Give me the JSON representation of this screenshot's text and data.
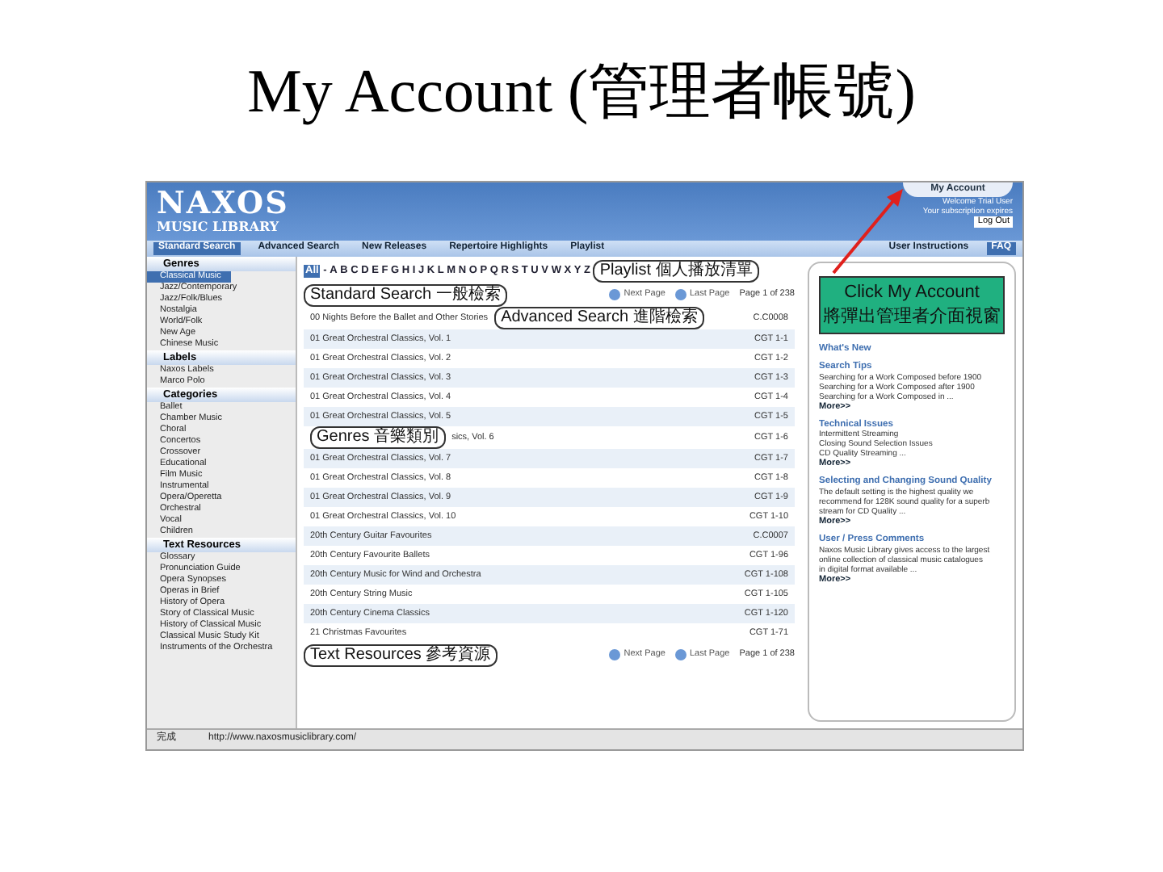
{
  "title": "My Account (管理者帳號)",
  "header": {
    "logo_top": "NAXOS",
    "logo_bottom": "MUSIC LIBRARY",
    "account_tab": "My Account",
    "welcome": [
      "Welcome Trial User",
      "Your subscription expires"
    ],
    "logout": "Log Out"
  },
  "nav": [
    {
      "label": "Standard Search",
      "selected": true
    },
    {
      "label": "Advanced Search",
      "selected": false
    },
    {
      "label": "New Releases",
      "selected": false
    },
    {
      "label": "Repertoire Highlights",
      "selected": false
    },
    {
      "label": "Playlist",
      "selected": false
    }
  ],
  "nav_right": [
    {
      "label": "User Instructions",
      "selected": false
    },
    {
      "label": "FAQ",
      "selected": true
    }
  ],
  "sidebar": [
    {
      "heading": "Genres",
      "items": [
        {
          "label": "Classical Music",
          "selected": true
        },
        {
          "label": "Jazz/Contemporary",
          "selected": false
        },
        {
          "label": "Jazz/Folk/Blues",
          "selected": false
        },
        {
          "label": "Nostalgia",
          "selected": false
        },
        {
          "label": "World/Folk",
          "selected": false
        },
        {
          "label": "New Age",
          "selected": false
        },
        {
          "label": "Chinese Music",
          "selected": false
        }
      ]
    },
    {
      "heading": "Labels",
      "items": [
        {
          "label": "Naxos Labels",
          "selected": false
        },
        {
          "label": "Marco Polo",
          "selected": false
        }
      ]
    },
    {
      "heading": "Categories",
      "items": [
        {
          "label": "Ballet",
          "selected": false
        },
        {
          "label": "Chamber Music",
          "selected": false
        },
        {
          "label": "Choral",
          "selected": false
        },
        {
          "label": "Concertos",
          "selected": false
        },
        {
          "label": "Crossover",
          "selected": false
        },
        {
          "label": "Educational",
          "selected": false
        },
        {
          "label": "Film Music",
          "selected": false
        },
        {
          "label": "Instrumental",
          "selected": false
        },
        {
          "label": "Opera/Operetta",
          "selected": false
        },
        {
          "label": "Orchestral",
          "selected": false
        },
        {
          "label": "Vocal",
          "selected": false
        },
        {
          "label": "Children",
          "selected": false
        }
      ]
    },
    {
      "heading": "Text Resources",
      "items": [
        {
          "label": "Glossary",
          "selected": false
        },
        {
          "label": "Pronunciation Guide",
          "selected": false
        },
        {
          "label": "Opera Synopses",
          "selected": false
        },
        {
          "label": "Operas in Brief",
          "selected": false
        },
        {
          "label": "History of Opera",
          "selected": false
        },
        {
          "label": "Story of Classical Music",
          "selected": false
        },
        {
          "label": "History of Classical Music",
          "selected": false
        },
        {
          "label": "Classical Music Study Kit",
          "selected": false
        },
        {
          "label": "Instruments of the Orchestra",
          "selected": false
        }
      ]
    }
  ],
  "alphabet": [
    {
      "label": "All",
      "selected": true
    },
    {
      "label": "-",
      "selected": false
    },
    {
      "label": "A",
      "selected": false
    },
    {
      "label": "B",
      "selected": false
    },
    {
      "label": "C",
      "selected": false
    },
    {
      "label": "D",
      "selected": false
    },
    {
      "label": "E",
      "selected": false
    },
    {
      "label": "F",
      "selected": false
    },
    {
      "label": "G",
      "selected": false
    },
    {
      "label": "H",
      "selected": false
    },
    {
      "label": "I",
      "selected": false
    },
    {
      "label": "J",
      "selected": false
    },
    {
      "label": "K",
      "selected": false
    },
    {
      "label": "L",
      "selected": false
    },
    {
      "label": "M",
      "selected": false
    },
    {
      "label": "N",
      "selected": false
    },
    {
      "label": "O",
      "selected": false
    },
    {
      "label": "P",
      "selected": false
    },
    {
      "label": "Q",
      "selected": false
    },
    {
      "label": "R",
      "selected": false
    },
    {
      "label": "S",
      "selected": false
    },
    {
      "label": "T",
      "selected": false
    },
    {
      "label": "U",
      "selected": false
    },
    {
      "label": "V",
      "selected": false
    },
    {
      "label": "W",
      "selected": false
    },
    {
      "label": "X",
      "selected": false
    },
    {
      "label": "Y",
      "selected": false
    },
    {
      "label": "Z",
      "selected": false
    }
  ],
  "alphabet_callout": "Playlist 個人播放清單",
  "pager_top": {
    "callout": "Standard Search 一般檢索",
    "next": "Next Page",
    "last": "Last Page",
    "page": "Page 1 of 238"
  },
  "rows": [
    {
      "title": "00 Nights Before the Ballet and Other Stories",
      "callout": "Advanced Search 進階檢索",
      "code": "C.C0008"
    },
    {
      "title": "01 Great Orchestral Classics, Vol. 1",
      "code": "CGT 1-1"
    },
    {
      "title": "01 Great Orchestral Classics, Vol. 2",
      "code": "CGT 1-2"
    },
    {
      "title": "01 Great Orchestral Classics, Vol. 3",
      "code": "CGT 1-3"
    },
    {
      "title": "01 Great Orchestral Classics, Vol. 4",
      "code": "CGT 1-4"
    },
    {
      "title": "01 Great Orchestral Classics, Vol. 5",
      "code": "CGT 1-5"
    },
    {
      "lead_callout": "Genres 音樂類別",
      "title": "sics, Vol. 6",
      "code": "CGT 1-6"
    },
    {
      "title": "01 Great Orchestral Classics, Vol. 7",
      "code": "CGT 1-7"
    },
    {
      "title": "01 Great Orchestral Classics, Vol. 8",
      "code": "CGT 1-8"
    },
    {
      "title": "01 Great Orchestral Classics, Vol. 9",
      "code": "CGT 1-9"
    },
    {
      "title": "01 Great Orchestral Classics, Vol. 10",
      "code": "CGT 1-10"
    },
    {
      "title": "20th Century Guitar Favourites",
      "code": "C.C0007"
    },
    {
      "title": "20th Century Favourite Ballets",
      "code": "CGT 1-96"
    },
    {
      "title": "20th Century Music for Wind and Orchestra",
      "code": "CGT 1-108"
    },
    {
      "title": "20th Century String Music",
      "code": "CGT 1-105"
    },
    {
      "title": "20th Century Cinema Classics",
      "code": "CGT 1-120"
    },
    {
      "title": "21 Christmas Favourites",
      "code": "CGT 1-71"
    }
  ],
  "pager_bottom": {
    "callout": "Text Resources 參考資源",
    "next": "Next Page",
    "last": "Last Page",
    "page": "Page 1 of 238"
  },
  "note": {
    "lines": [
      "Click My Account",
      "將彈出管理者介面視窗"
    ]
  },
  "news": [
    {
      "heading": "What's New"
    },
    {
      "heading": "Search Tips",
      "lines": [
        "Searching for a Work Composed before 1900",
        "Searching for a Work Composed after 1900",
        "Searching for a Work Composed in ..."
      ],
      "more": "More>>"
    },
    {
      "heading": "Technical Issues",
      "lines": [
        "Intermittent Streaming",
        "Closing Sound Selection Issues",
        "CD Quality Streaming ..."
      ],
      "more": "More>>"
    },
    {
      "heading": "Selecting and Changing Sound Quality",
      "lines": [
        "The default setting is the highest quality we",
        "recommend for 128K sound quality for a superb",
        "stream for CD Quality ..."
      ],
      "more": "More>>"
    },
    {
      "heading": "User / Press Comments",
      "lines": [
        "Naxos Music Library gives access to the largest",
        "online collection of classical music catalogues",
        "in digital format available ..."
      ],
      "more": "More>>"
    }
  ],
  "status": {
    "done": "完成",
    "address": "http://www.naxosmusiclibrary.com/"
  }
}
